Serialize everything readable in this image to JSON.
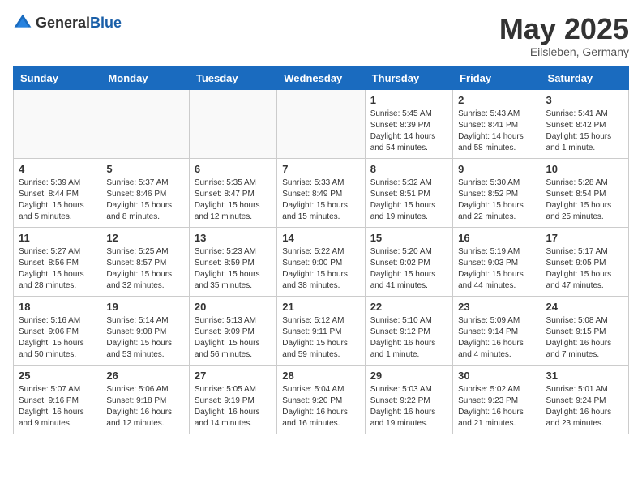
{
  "header": {
    "logo_general": "General",
    "logo_blue": "Blue",
    "month_year": "May 2025",
    "location": "Eilsleben, Germany"
  },
  "weekdays": [
    "Sunday",
    "Monday",
    "Tuesday",
    "Wednesday",
    "Thursday",
    "Friday",
    "Saturday"
  ],
  "weeks": [
    [
      {
        "day": "",
        "info": ""
      },
      {
        "day": "",
        "info": ""
      },
      {
        "day": "",
        "info": ""
      },
      {
        "day": "",
        "info": ""
      },
      {
        "day": "1",
        "info": "Sunrise: 5:45 AM\nSunset: 8:39 PM\nDaylight: 14 hours\nand 54 minutes."
      },
      {
        "day": "2",
        "info": "Sunrise: 5:43 AM\nSunset: 8:41 PM\nDaylight: 14 hours\nand 58 minutes."
      },
      {
        "day": "3",
        "info": "Sunrise: 5:41 AM\nSunset: 8:42 PM\nDaylight: 15 hours\nand 1 minute."
      }
    ],
    [
      {
        "day": "4",
        "info": "Sunrise: 5:39 AM\nSunset: 8:44 PM\nDaylight: 15 hours\nand 5 minutes."
      },
      {
        "day": "5",
        "info": "Sunrise: 5:37 AM\nSunset: 8:46 PM\nDaylight: 15 hours\nand 8 minutes."
      },
      {
        "day": "6",
        "info": "Sunrise: 5:35 AM\nSunset: 8:47 PM\nDaylight: 15 hours\nand 12 minutes."
      },
      {
        "day": "7",
        "info": "Sunrise: 5:33 AM\nSunset: 8:49 PM\nDaylight: 15 hours\nand 15 minutes."
      },
      {
        "day": "8",
        "info": "Sunrise: 5:32 AM\nSunset: 8:51 PM\nDaylight: 15 hours\nand 19 minutes."
      },
      {
        "day": "9",
        "info": "Sunrise: 5:30 AM\nSunset: 8:52 PM\nDaylight: 15 hours\nand 22 minutes."
      },
      {
        "day": "10",
        "info": "Sunrise: 5:28 AM\nSunset: 8:54 PM\nDaylight: 15 hours\nand 25 minutes."
      }
    ],
    [
      {
        "day": "11",
        "info": "Sunrise: 5:27 AM\nSunset: 8:56 PM\nDaylight: 15 hours\nand 28 minutes."
      },
      {
        "day": "12",
        "info": "Sunrise: 5:25 AM\nSunset: 8:57 PM\nDaylight: 15 hours\nand 32 minutes."
      },
      {
        "day": "13",
        "info": "Sunrise: 5:23 AM\nSunset: 8:59 PM\nDaylight: 15 hours\nand 35 minutes."
      },
      {
        "day": "14",
        "info": "Sunrise: 5:22 AM\nSunset: 9:00 PM\nDaylight: 15 hours\nand 38 minutes."
      },
      {
        "day": "15",
        "info": "Sunrise: 5:20 AM\nSunset: 9:02 PM\nDaylight: 15 hours\nand 41 minutes."
      },
      {
        "day": "16",
        "info": "Sunrise: 5:19 AM\nSunset: 9:03 PM\nDaylight: 15 hours\nand 44 minutes."
      },
      {
        "day": "17",
        "info": "Sunrise: 5:17 AM\nSunset: 9:05 PM\nDaylight: 15 hours\nand 47 minutes."
      }
    ],
    [
      {
        "day": "18",
        "info": "Sunrise: 5:16 AM\nSunset: 9:06 PM\nDaylight: 15 hours\nand 50 minutes."
      },
      {
        "day": "19",
        "info": "Sunrise: 5:14 AM\nSunset: 9:08 PM\nDaylight: 15 hours\nand 53 minutes."
      },
      {
        "day": "20",
        "info": "Sunrise: 5:13 AM\nSunset: 9:09 PM\nDaylight: 15 hours\nand 56 minutes."
      },
      {
        "day": "21",
        "info": "Sunrise: 5:12 AM\nSunset: 9:11 PM\nDaylight: 15 hours\nand 59 minutes."
      },
      {
        "day": "22",
        "info": "Sunrise: 5:10 AM\nSunset: 9:12 PM\nDaylight: 16 hours\nand 1 minute."
      },
      {
        "day": "23",
        "info": "Sunrise: 5:09 AM\nSunset: 9:14 PM\nDaylight: 16 hours\nand 4 minutes."
      },
      {
        "day": "24",
        "info": "Sunrise: 5:08 AM\nSunset: 9:15 PM\nDaylight: 16 hours\nand 7 minutes."
      }
    ],
    [
      {
        "day": "25",
        "info": "Sunrise: 5:07 AM\nSunset: 9:16 PM\nDaylight: 16 hours\nand 9 minutes."
      },
      {
        "day": "26",
        "info": "Sunrise: 5:06 AM\nSunset: 9:18 PM\nDaylight: 16 hours\nand 12 minutes."
      },
      {
        "day": "27",
        "info": "Sunrise: 5:05 AM\nSunset: 9:19 PM\nDaylight: 16 hours\nand 14 minutes."
      },
      {
        "day": "28",
        "info": "Sunrise: 5:04 AM\nSunset: 9:20 PM\nDaylight: 16 hours\nand 16 minutes."
      },
      {
        "day": "29",
        "info": "Sunrise: 5:03 AM\nSunset: 9:22 PM\nDaylight: 16 hours\nand 19 minutes."
      },
      {
        "day": "30",
        "info": "Sunrise: 5:02 AM\nSunset: 9:23 PM\nDaylight: 16 hours\nand 21 minutes."
      },
      {
        "day": "31",
        "info": "Sunrise: 5:01 AM\nSunset: 9:24 PM\nDaylight: 16 hours\nand 23 minutes."
      }
    ]
  ]
}
